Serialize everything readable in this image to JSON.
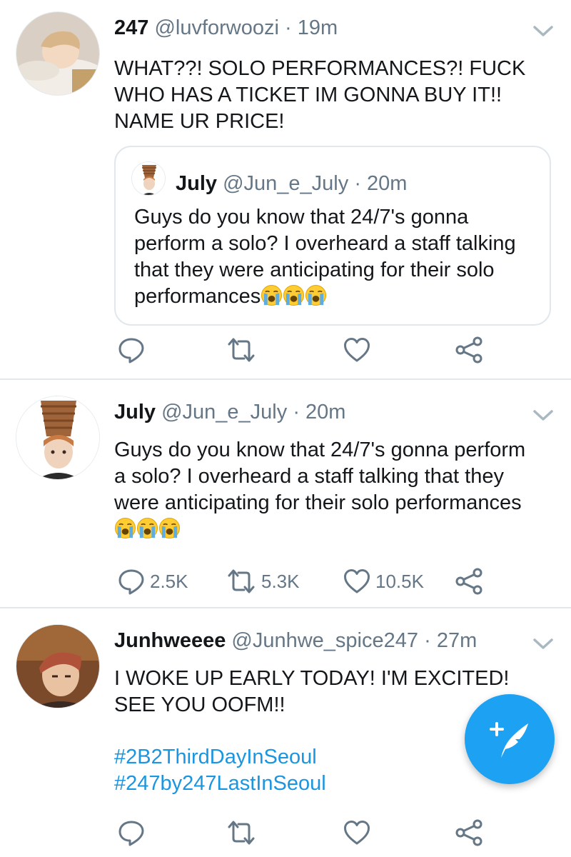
{
  "tweets": [
    {
      "display_name": "247",
      "handle": "@luvforwoozi",
      "separator": "·",
      "time": "19m",
      "text": "WHAT??! SOLO PERFORMANCES?! FUCK WHO HAS A TICKET IM GONNA BUY IT!! NAME UR PRICE!",
      "quoted": {
        "display_name": "July",
        "handle": "@Jun_e_July",
        "separator": "·",
        "time": "20m",
        "text": "Guys do you know that 24/7's gonna perform a solo? I overheard a staff talking that they were anticipating for their solo performances",
        "emojis": [
          "loudly-crying-face",
          "loudly-crying-face",
          "loudly-crying-face"
        ]
      },
      "actions": {
        "reply": "",
        "retweet": "",
        "like": ""
      }
    },
    {
      "display_name": "July",
      "handle": "@Jun_e_July",
      "separator": "·",
      "time": "20m",
      "text": "Guys do you know that 24/7's gonna perform a solo? I overheard a staff talking that they were anticipating for their solo performances",
      "emojis": [
        "loudly-crying-face",
        "loudly-crying-face",
        "loudly-crying-face"
      ],
      "actions": {
        "reply": "2.5K",
        "retweet": "5.3K",
        "like": "10.5K"
      }
    },
    {
      "display_name": "Junhweeee",
      "handle": "@Junhwe_spice247",
      "separator": "·",
      "time": "27m",
      "text_line1": "I WOKE UP EARLY TODAY! I'M EXCITED!",
      "text_line2": "SEE YOU OOFM!!",
      "hashtags": [
        "#2B2ThirdDayInSeoul",
        "#247by247LastInSeoul"
      ],
      "actions": {
        "reply": "",
        "retweet": "",
        "like": ""
      }
    }
  ],
  "colors": {
    "accent": "#1da1f2",
    "hashtag": "#1b95e0",
    "secondary_text": "#657786",
    "divider": "#e1e8ed"
  },
  "icons": [
    "reply-icon",
    "retweet-icon",
    "like-icon",
    "share-icon",
    "chevron-down-icon",
    "compose-tweet-icon"
  ]
}
